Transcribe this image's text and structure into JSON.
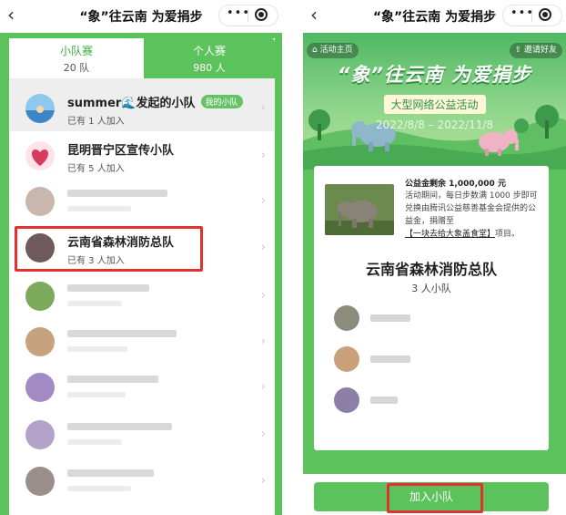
{
  "left": {
    "nav": {
      "back": "‹",
      "title": "“象”往云南 为爱捐步",
      "more": "•••"
    },
    "tabs": [
      {
        "label": "小队赛",
        "count": "20 队"
      },
      {
        "label": "个人赛",
        "count": "980 人"
      }
    ],
    "teams": [
      {
        "name": "summer🌊发起的小队",
        "badge": "我的小队",
        "members": "已有 1 人加入"
      },
      {
        "name": "昆明晋宁区宣传小队",
        "members": "已有 5 人加入"
      },
      {
        "name": "云南省森林消防总队",
        "members": "已有 3 人加入"
      }
    ],
    "chevron": "›"
  },
  "right": {
    "nav": {
      "back": "‹",
      "title": "“象”往云南 为爱捐步",
      "more": "•••"
    },
    "banner": {
      "home_button": "⌂ 活动主页",
      "invite_button": "⇧ 邀请好友",
      "title": "“象”往云南 为爱捐步",
      "subtitle": "大型网络公益活动",
      "dates": "2022/8/8 – 2022/11/8"
    },
    "fund": {
      "remaining": "公益金剩余 1,000,000 元",
      "desc_before": "活动期间，每日步数满 1000 步即可兑换由腾讯公益慈善基金会提供的公益金，捐赠至",
      "link": "【一块去给大象盖食堂】",
      "desc_after": "项目。"
    },
    "team": {
      "name": "云南省森林消防总队",
      "size": "3 人小队"
    },
    "join_button": "加入小队"
  },
  "colors": {
    "brand_green": "#5cc35c",
    "highlight_red": "#e23131"
  }
}
